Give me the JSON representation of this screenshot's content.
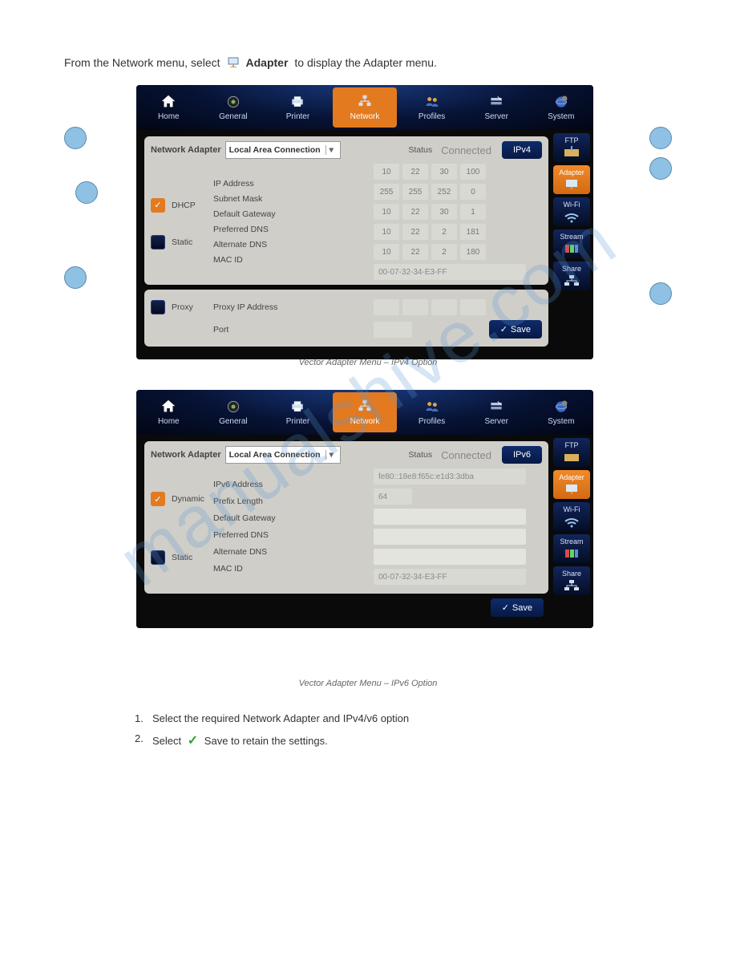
{
  "title_prefix": "From the Network menu, select",
  "adapter_word": "Adapter",
  "title_suffix": "to display the Adapter menu.",
  "topnav": {
    "home": "Home",
    "general": "General",
    "printer": "Printer",
    "network": "Network",
    "profiles": "Profiles",
    "server": "Server",
    "system": "System"
  },
  "sidetabs": {
    "ftp": "FTP",
    "adapter": "Adapter",
    "wifi": "Wi-Fi",
    "stream": "Stream",
    "share": "Share"
  },
  "panel1": {
    "adapter_label": "Network Adapter",
    "adapter_value": "Local Area Connection",
    "status_label": "Status",
    "status_value": "Connected",
    "ipv_button": "IPv4",
    "dhcp": "DHCP",
    "static": "Static",
    "ip_address_label": "IP Address",
    "subnet_label": "Subnet Mask",
    "gateway_label": "Default Gateway",
    "pdns_label": "Preferred DNS",
    "adns_label": "Alternate DNS",
    "mac_label": "MAC ID",
    "ip": [
      "10",
      "22",
      "30",
      "100"
    ],
    "subnet": [
      "255",
      "255",
      "252",
      "0"
    ],
    "gateway": [
      "10",
      "22",
      "30",
      "1"
    ],
    "pdns": [
      "10",
      "22",
      "2",
      "181"
    ],
    "adns": [
      "10",
      "22",
      "2",
      "180"
    ],
    "mac": "00-07-32-34-E3-FF",
    "proxy": "Proxy",
    "proxy_ip_label": "Proxy IP Address",
    "port_label": "Port",
    "save": "Save"
  },
  "panel2": {
    "adapter_label": "Network Adapter",
    "adapter_value": "Local Area Connection",
    "status_label": "Status",
    "status_value": "Connected",
    "ipv_button": "IPv6",
    "dynamic": "Dynamic",
    "static": "Static",
    "ipv6addr_label": "IPv6 Address",
    "prefix_label": "Prefix Length",
    "gateway_label": "Default Gateway",
    "pdns_label": "Preferred DNS",
    "adns_label": "Alternate DNS",
    "mac_label": "MAC ID",
    "ipv6addr": "fe80::18e8:f65c:e1d3:3dba",
    "prefix": "64",
    "mac": "00-07-32-34-E3-FF",
    "save": "Save"
  },
  "caption1": "Vector Adapter Menu – IPv4 Option",
  "caption2": "Vector Adapter Menu – IPv6 Option",
  "instructions": {
    "n1": "1.",
    "t1": "Select the required Network Adapter and IPv4/v6 option",
    "n2": "2.",
    "t2_a": "Select",
    "t2_b": "Save to retain the settings."
  },
  "watermark": "manualshive.com"
}
